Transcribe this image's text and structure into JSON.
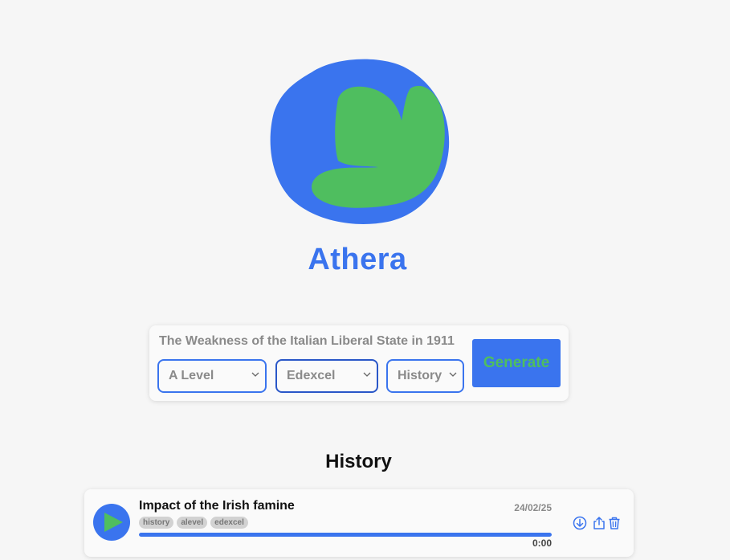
{
  "app": {
    "name": "Athera",
    "colors": {
      "primary": "#3a74ee",
      "accent": "#4fbe5f",
      "background": "#f6f6f6"
    }
  },
  "generator": {
    "topic_value": "The Weakness of the Italian Liberal State in 1911",
    "level_select": {
      "value": "A Level",
      "icon": "chevron-down-icon"
    },
    "board_select": {
      "value": "Edexcel",
      "icon": "chevron-down-icon"
    },
    "subject_select": {
      "value": "History",
      "icon": "chevron-down-icon"
    },
    "generate_label": "Generate"
  },
  "history": {
    "title": "History",
    "items": [
      {
        "title": "Impact of the Irish famine",
        "date": "24/02/25",
        "tags": [
          "history",
          "alevel",
          "edexcel"
        ],
        "progress_percent": 100,
        "time": "0:00",
        "icons": [
          "play-icon",
          "download-icon",
          "share-icon",
          "trash-icon"
        ]
      }
    ]
  }
}
